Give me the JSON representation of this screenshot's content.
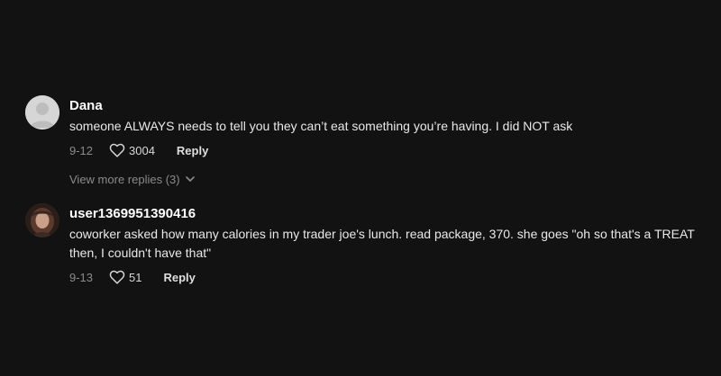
{
  "comments": [
    {
      "username": "Dana",
      "text": "someone ALWAYS needs to tell you they can’t eat something you’re having. I did NOT ask",
      "date": "9-12",
      "likes": "3004",
      "reply_label": "Reply"
    },
    {
      "username": "user1369951390416",
      "text": "coworker asked how many calories in my trader joe's lunch. read package, 370. she goes \"oh so that's a TREAT then, I couldn't have that\"",
      "date": "9-13",
      "likes": "51",
      "reply_label": "Reply"
    }
  ],
  "view_more": "View more replies (3)",
  "colors": {
    "background": "#121212",
    "text": "#e9e9e9",
    "muted": "#8b8b8b"
  }
}
